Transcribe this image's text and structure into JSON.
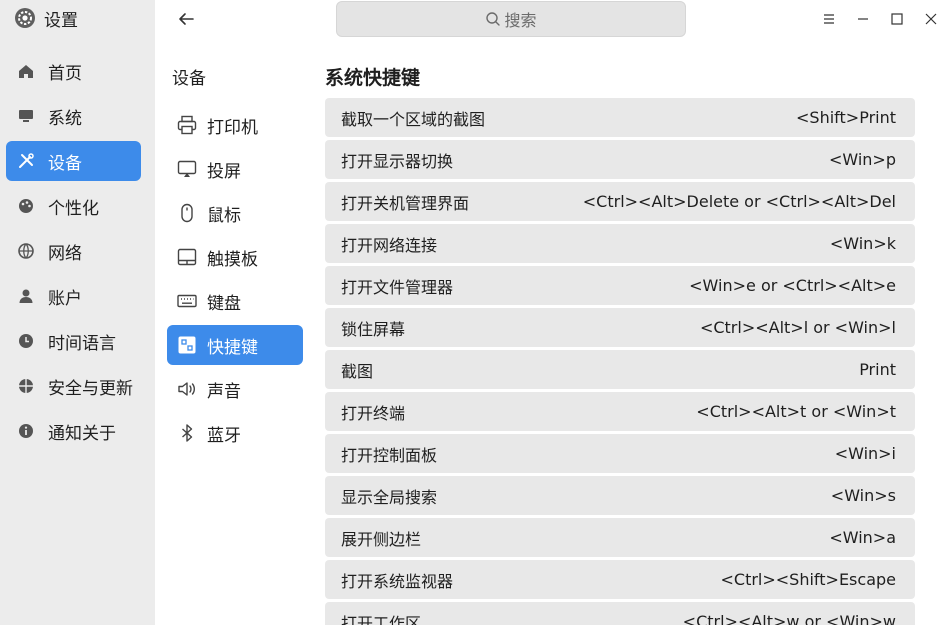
{
  "app": {
    "title": "设置"
  },
  "sidebar": {
    "items": [
      {
        "label": "首页",
        "icon": "home-icon",
        "active": false
      },
      {
        "label": "系统",
        "icon": "monitor-icon",
        "active": false
      },
      {
        "label": "设备",
        "icon": "tools-icon",
        "active": true
      },
      {
        "label": "个性化",
        "icon": "palette-icon",
        "active": false
      },
      {
        "label": "网络",
        "icon": "globe-icon",
        "active": false
      },
      {
        "label": "账户",
        "icon": "user-icon",
        "active": false
      },
      {
        "label": "时间语言",
        "icon": "clock-icon",
        "active": false
      },
      {
        "label": "安全与更新",
        "icon": "shield-icon",
        "active": false
      },
      {
        "label": "通知关于",
        "icon": "info-icon",
        "active": false
      }
    ]
  },
  "search": {
    "placeholder": "搜索"
  },
  "subnav": {
    "title": "设备",
    "items": [
      {
        "label": "打印机",
        "icon": "printer-icon",
        "active": false
      },
      {
        "label": "投屏",
        "icon": "cast-icon",
        "active": false
      },
      {
        "label": "鼠标",
        "icon": "mouse-icon",
        "active": false
      },
      {
        "label": "触摸板",
        "icon": "touchpad-icon",
        "active": false
      },
      {
        "label": "键盘",
        "icon": "keyboard-icon",
        "active": false
      },
      {
        "label": "快捷键",
        "icon": "shortcut-icon",
        "active": true
      },
      {
        "label": "声音",
        "icon": "speaker-icon",
        "active": false
      },
      {
        "label": "蓝牙",
        "icon": "bluetooth-icon",
        "active": false
      }
    ]
  },
  "main": {
    "title": "系统快捷键",
    "shortcuts": [
      {
        "name": "截取一个区域的截图",
        "key": "<Shift>Print"
      },
      {
        "name": "打开显示器切换",
        "key": "<Win>p"
      },
      {
        "name": "打开关机管理界面",
        "key": "<Ctrl><Alt>Delete or <Ctrl><Alt>Del"
      },
      {
        "name": "打开网络连接",
        "key": "<Win>k"
      },
      {
        "name": "打开文件管理器",
        "key": "<Win>e or <Ctrl><Alt>e"
      },
      {
        "name": "锁住屏幕",
        "key": "<Ctrl><Alt>l or <Win>l"
      },
      {
        "name": "截图",
        "key": "Print"
      },
      {
        "name": "打开终端",
        "key": "<Ctrl><Alt>t or <Win>t"
      },
      {
        "name": "打开控制面板",
        "key": "<Win>i"
      },
      {
        "name": "显示全局搜索",
        "key": "<Win>s"
      },
      {
        "name": "展开侧边栏",
        "key": "<Win>a"
      },
      {
        "name": "打开系统监视器",
        "key": "<Ctrl><Shift>Escape"
      },
      {
        "name": "打开工作区",
        "key": "<Ctrl><Alt>w or <Win>w"
      }
    ]
  },
  "colors": {
    "accent": "#3d8bea",
    "sidebar_bg": "#ececec",
    "row_bg": "#e8e8e8"
  }
}
